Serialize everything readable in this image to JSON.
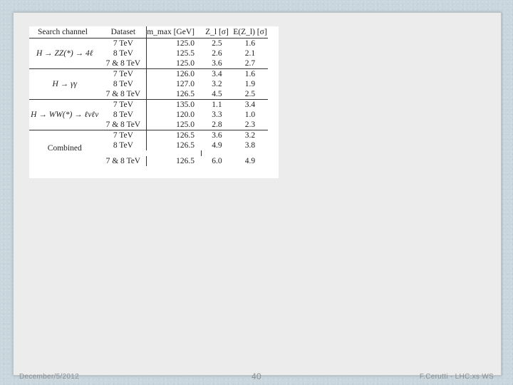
{
  "table": {
    "headers": [
      "Search channel",
      "Dataset",
      "m_max [GeV]",
      "Z_l [σ]",
      "E(Z_l) [σ]"
    ],
    "groups": [
      {
        "channel": "H → ZZ(*) → 4ℓ",
        "rows": [
          [
            "7 TeV",
            "125.0",
            "2.5",
            "1.6"
          ],
          [
            "8 TeV",
            "125.5",
            "2.6",
            "2.1"
          ],
          [
            "7 & 8 TeV",
            "125.0",
            "3.6",
            "2.7"
          ]
        ]
      },
      {
        "channel": "H → γγ",
        "rows": [
          [
            "7 TeV",
            "126.0",
            "3.4",
            "1.6"
          ],
          [
            "8 TeV",
            "127.0",
            "3.2",
            "1.9"
          ],
          [
            "7 & 8 TeV",
            "126.5",
            "4.5",
            "2.5"
          ]
        ]
      },
      {
        "channel": "H → WW(*) → ℓνℓν",
        "rows": [
          [
            "7 TeV",
            "135.0",
            "1.1",
            "3.4"
          ],
          [
            "8 TeV",
            "120.0",
            "3.3",
            "1.0"
          ],
          [
            "7 & 8 TeV",
            "125.0",
            "2.8",
            "2.3"
          ]
        ]
      },
      {
        "channel": "Combined",
        "rows": [
          [
            "7 TeV",
            "126.5",
            "3.6",
            "3.2"
          ],
          [
            "8 TeV",
            "126.5",
            "4.9",
            "3.8"
          ],
          [
            "7 & 8 TeV",
            "126.5",
            "6.0",
            "4.9"
          ]
        ]
      }
    ]
  },
  "footer": {
    "date": "December/5/2012",
    "page": "40",
    "author": "F.Cerutti - LHC.xs WS"
  }
}
